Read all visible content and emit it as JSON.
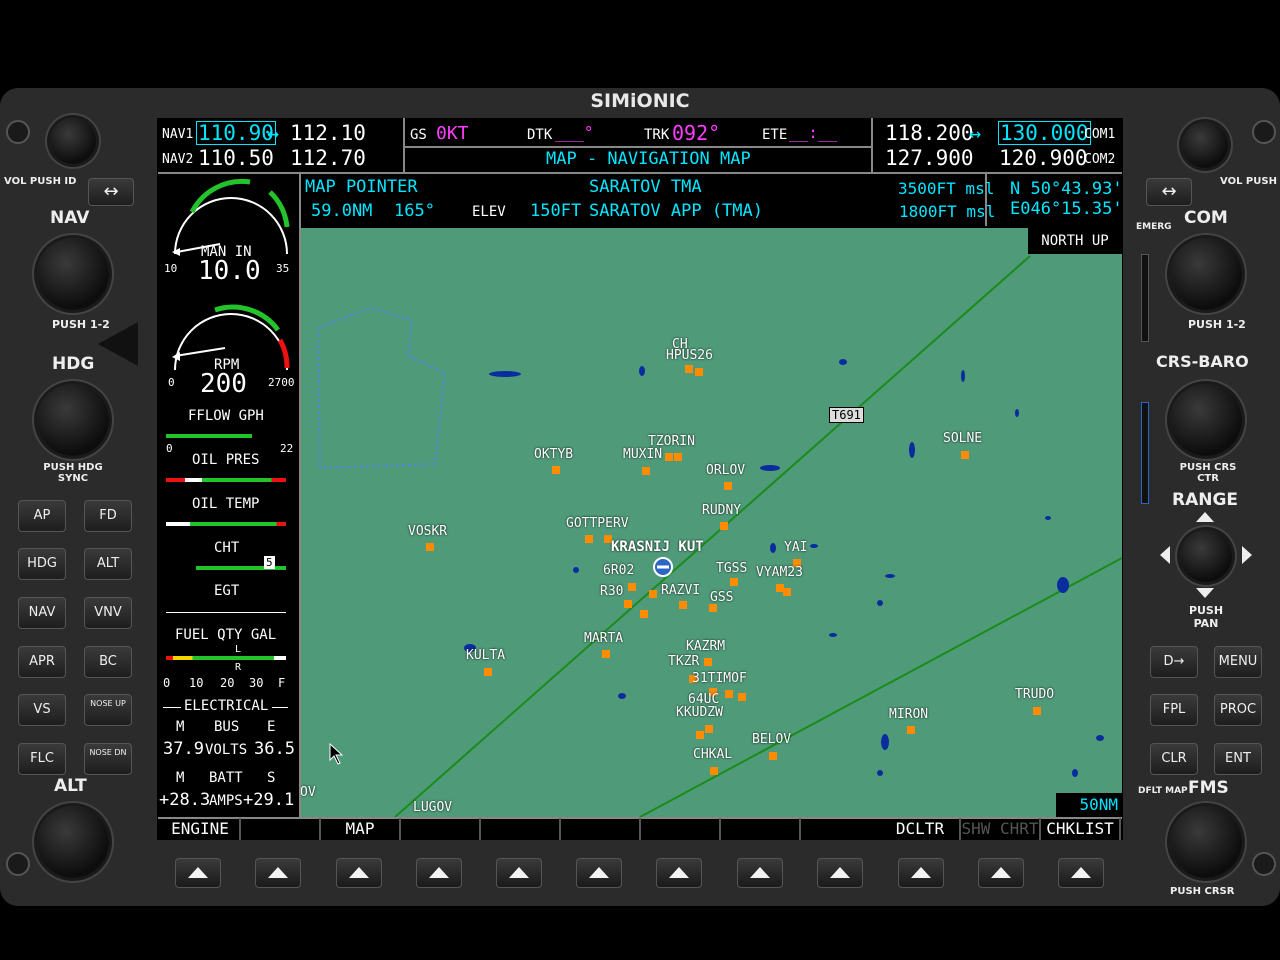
{
  "brand": "SIMiONIC",
  "nav": {
    "nav1_label": "NAV1",
    "nav1_active": "110.90",
    "nav1_arrow": "↔",
    "nav1_standby": "112.10",
    "nav2_label": "NAV2",
    "nav2_active": "110.50",
    "nav2_standby": "112.70"
  },
  "status": {
    "gs_label": "GS",
    "gs_value": "0KT",
    "dtk_label": "DTK",
    "dtk_value": "___°",
    "trk_label": "TRK",
    "trk_value": "092°",
    "ete_label": "ETE",
    "ete_value": "__:__",
    "page_title": "MAP - NAVIGATION MAP"
  },
  "com": {
    "com1_active": "118.200",
    "com1_arrow": "↔",
    "com1_standby": "130.000",
    "com1_label": "COM1",
    "com2_active": "127.900",
    "com2_standby": "120.900",
    "com2_label": "COM2"
  },
  "pointer": {
    "title": "MAP POINTER",
    "distance": "59.0NM",
    "bearing": "165°",
    "elev_label": "ELEV",
    "elev_value": "150FT",
    "airspace_name": "SARATOV TMA",
    "airspace_sub": "SARATOV APP (TMA)",
    "ceiling": "3500FT msl",
    "floor": "1800FT msl",
    "lat": "N 50°43.93'",
    "lon": "E046°15.35'"
  },
  "map": {
    "orientation": "NORTH UP",
    "range": "50NM",
    "airway": "T691",
    "waypoints": [
      {
        "name": "CH",
        "type": "label"
      },
      {
        "name": "HPUS26",
        "type": "wp"
      },
      {
        "name": "TZORIN",
        "type": "wp"
      },
      {
        "name": "OKTYB",
        "type": "wp"
      },
      {
        "name": "MUXIN",
        "type": "wp"
      },
      {
        "name": "ORLOV",
        "type": "wp"
      },
      {
        "name": "SOLNE",
        "type": "wp"
      },
      {
        "name": "RUDNY",
        "type": "wp"
      },
      {
        "name": "GOTTPERV",
        "type": "wp"
      },
      {
        "name": "VOSKR",
        "type": "wp"
      },
      {
        "name": "KRASNIJ KUT",
        "type": "airport"
      },
      {
        "name": "YAI",
        "type": "wp"
      },
      {
        "name": "TGSS",
        "type": "wp"
      },
      {
        "name": "VYAM23",
        "type": "wp"
      },
      {
        "name": "6R02",
        "type": "wp"
      },
      {
        "name": "R30",
        "type": "wp"
      },
      {
        "name": "RAZVI",
        "type": "wp"
      },
      {
        "name": "GSS",
        "type": "wp"
      },
      {
        "name": "MARTA",
        "type": "wp"
      },
      {
        "name": "KAZRM",
        "type": "wp"
      },
      {
        "name": "KULTA",
        "type": "wp"
      },
      {
        "name": "TKZR",
        "type": "wp"
      },
      {
        "name": "31TIMOF",
        "type": "wp"
      },
      {
        "name": "64UC",
        "type": "wp"
      },
      {
        "name": "KKUDZW",
        "type": "wp"
      },
      {
        "name": "TRUDO",
        "type": "wp"
      },
      {
        "name": "MIRON",
        "type": "wp"
      },
      {
        "name": "BELOV",
        "type": "wp"
      },
      {
        "name": "CHKAL",
        "type": "wp"
      },
      {
        "name": "LUGOV",
        "type": "wp"
      },
      {
        "name": "OV",
        "type": "label"
      }
    ]
  },
  "engine": {
    "man_label": "MAN IN",
    "man_value": "10.0",
    "man_min": "10",
    "man_max": "35",
    "rpm_label": "RPM",
    "rpm_value": "200",
    "rpm_min": "0",
    "rpm_max": "2700",
    "fflow_label": "FFLOW GPH",
    "fflow_min": "0",
    "fflow_max": "22",
    "oilp_label": "OIL PRES",
    "oilt_label": "OIL TEMP",
    "cht_label": "CHT",
    "cht_marker": "5",
    "egt_label": "EGT",
    "fuel_label": "FUEL QTY GAL",
    "fuel_ticks": [
      "0",
      "10",
      "20",
      "30",
      "F"
    ],
    "fuel_l": "L",
    "fuel_r": "R",
    "elec_label": "ELECTRICAL",
    "bus_m": "M",
    "bus_label": "BUS",
    "bus_e": "E",
    "volts_m": "37.9",
    "volts_label": "VOLTS",
    "volts_e": "36.5",
    "batt_m": "M",
    "batt_label": "BATT",
    "batt_s": "S",
    "amps_m": "+28.3",
    "amps_label": "AMPS",
    "amps_s": "+29.1"
  },
  "softkeys": [
    "ENGINE",
    "",
    "MAP",
    "",
    "",
    "",
    "",
    "",
    "DCLTR",
    "SHW CHRT",
    "CHKLIST"
  ],
  "left_panel": {
    "vol_push_id": "VOL PUSH ID",
    "nav": "NAV",
    "push12": "PUSH 1-2",
    "hdg": "HDG",
    "push_hdg_sync": "PUSH HDG SYNC",
    "alt": "ALT",
    "buttons": [
      "AP",
      "FD",
      "HDG",
      "ALT",
      "NAV",
      "VNV",
      "APR",
      "BC",
      "VS",
      "NOSE UP",
      "FLC",
      "NOSE DN"
    ]
  },
  "right_panel": {
    "vol_push_sq": "VOL PUSH SQ",
    "emerg": "EMERG",
    "com": "COM",
    "push12": "PUSH 1-2",
    "crs_baro": "CRS-BARO",
    "push_crs_ctr": "PUSH CRS CTR",
    "range": "RANGE",
    "push_pan": "PUSH PAN",
    "buttons": [
      "D→",
      "MENU",
      "FPL",
      "PROC",
      "CLR",
      "ENT"
    ],
    "dflt_map": "DFLT MAP",
    "fms": "FMS",
    "push_crsr": "PUSH CRSR"
  },
  "colors": {
    "map_bg": "#4f9a79",
    "cyan": "#00e6ff",
    "magenta": "#ff3cff",
    "waypoint": "#ff8c00"
  }
}
